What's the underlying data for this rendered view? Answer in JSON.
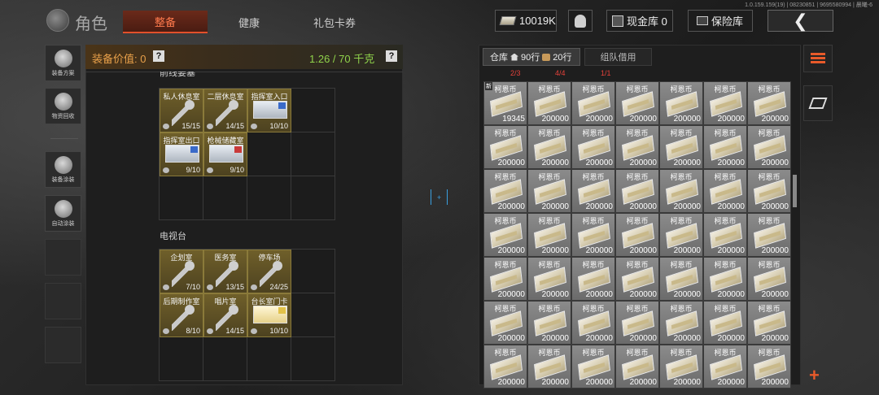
{
  "version": "1.0.159.159(19) | 08230851 | 9695580994 | 晨曦-6",
  "header": {
    "title": "角色",
    "tabs": [
      {
        "label": "整备",
        "active": true
      },
      {
        "label": "健康",
        "active": false
      },
      {
        "label": "礼包卡券",
        "active": false
      }
    ],
    "money": "10019K",
    "cash_label": "现金库 0",
    "safe_label": "保险库",
    "back_icon": "chevron-left-icon"
  },
  "sidebar": {
    "items": [
      {
        "label": "装备方案",
        "icon": "equipment-plan-icon"
      },
      {
        "label": "物资回收",
        "icon": "recycle-icon"
      },
      {
        "label": "装备涂装",
        "icon": "paint-helmet-icon"
      },
      {
        "label": "自动涂装",
        "icon": "auto-paint-icon"
      }
    ]
  },
  "left_panel": {
    "value_label": "装备价值: 0",
    "weight": "1.26 / 70 千克",
    "section1": {
      "title": "前线要塞",
      "items": [
        {
          "name": "私人休息室",
          "count": "15/15",
          "type": "key"
        },
        {
          "name": "二层休息室",
          "count": "14/15",
          "type": "key"
        },
        {
          "name": "指挥室入口",
          "count": "10/10",
          "type": "card"
        },
        {
          "name": "指挥室出口",
          "count": "9/10",
          "type": "card"
        },
        {
          "name": "枪械储藏室",
          "count": "9/10",
          "type": "card-red"
        }
      ]
    },
    "section2": {
      "title": "电视台",
      "items": [
        {
          "name": "企划室",
          "count": "7/10",
          "type": "key"
        },
        {
          "name": "医务室",
          "count": "13/15",
          "type": "key"
        },
        {
          "name": "停车场",
          "count": "24/25",
          "type": "key"
        },
        {
          "name": "后期制作室",
          "count": "8/10",
          "type": "key"
        },
        {
          "name": "唱片室",
          "count": "14/15",
          "type": "key"
        },
        {
          "name": "台长室门卡",
          "count": "10/10",
          "type": "card-gold"
        }
      ]
    }
  },
  "warehouse": {
    "tab_label": "仓库",
    "rows_a": "90行",
    "rows_b": "20行",
    "team_tab": "组队借用",
    "stats": [
      "2/3",
      "4/4",
      "1/1"
    ],
    "currency_name": "柯恩币",
    "new_badge": "新",
    "first_count": "19345",
    "default_count": "200000"
  },
  "colors": {
    "accent": "#e2502b",
    "value_orange": "#e8a04a",
    "weight_green": "#8fd24b",
    "item_gold": "#6f5f2a"
  }
}
